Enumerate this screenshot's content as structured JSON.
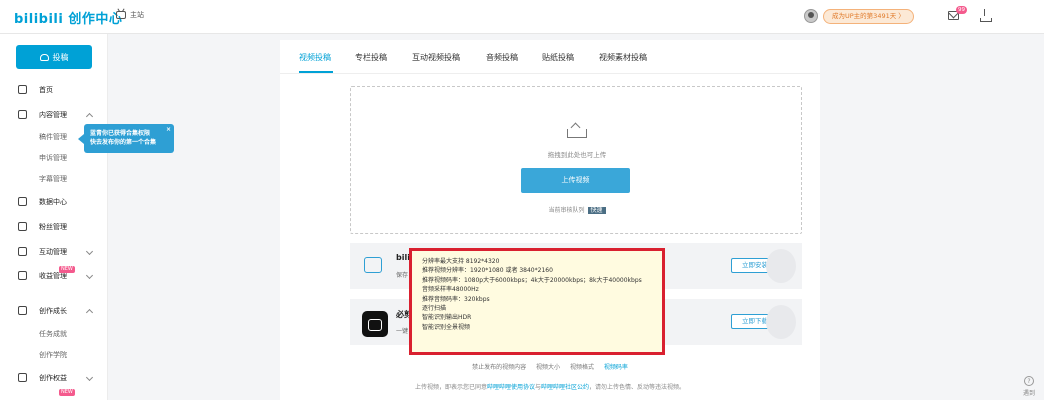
{
  "header": {
    "logo": "bilibili 创作中心",
    "home_label": "主站",
    "up_badge": "成为UP主的第3491天 〉",
    "mail_count": "99"
  },
  "sidebar": {
    "upload_label": "投稿",
    "items": [
      {
        "label": "首页"
      },
      {
        "label": "内容管理"
      },
      {
        "label": "稿件管理"
      },
      {
        "label": "申诉管理"
      },
      {
        "label": "字幕管理"
      },
      {
        "label": "数据中心"
      },
      {
        "label": "粉丝管理"
      },
      {
        "label": "互动管理"
      },
      {
        "label": "收益管理"
      },
      {
        "label": "创作成长"
      },
      {
        "label": "任务成就"
      },
      {
        "label": "创作学院"
      },
      {
        "label": "创作权益"
      }
    ],
    "new_tag": "NEW",
    "tip": {
      "line1": "蓝青你已获得合集权限",
      "line2": "快去发布你的第一个合集",
      "close": "×"
    }
  },
  "tabs": [
    "视频投稿",
    "专栏投稿",
    "互动视频投稿",
    "音频投稿",
    "贴纸投稿",
    "视频素材投稿"
  ],
  "upload": {
    "drop_hint": "拖拽到此处也可上传",
    "button": "上传视频",
    "queue_label": "当前审核队列",
    "queue_status": "快速"
  },
  "cards": [
    {
      "title": "bili",
      "desc": "保存",
      "button": "立即安装"
    },
    {
      "title": "必剪",
      "desc": "一键",
      "button": "立即下载"
    }
  ],
  "popup_lines": [
    "分辨率最大支持 8192*4320",
    "推荐视频分辨率：1920*1080 或者 3840*2160",
    "推荐视频码率：1080p大于6000kbps；4k大于20000kbps；8k大于40000kbps",
    "音频采样率48000Hz",
    "推荐音频码率：320kbps",
    "逐行扫描",
    "智能识别输出HDR",
    "智能识别全景视频"
  ],
  "bottom_links": [
    "禁止发布的视频内容",
    "视频大小",
    "视频格式",
    "视频码率"
  ],
  "terms": {
    "prefix": "上传视频，即表示您已同意",
    "link1": "哔哩哔哩使用协议",
    "mid": "与",
    "link2": "哔哩哔哩社区公约",
    "suffix": "，请勿上传色情、反动等违法视频。"
  },
  "help_label": "遇到"
}
